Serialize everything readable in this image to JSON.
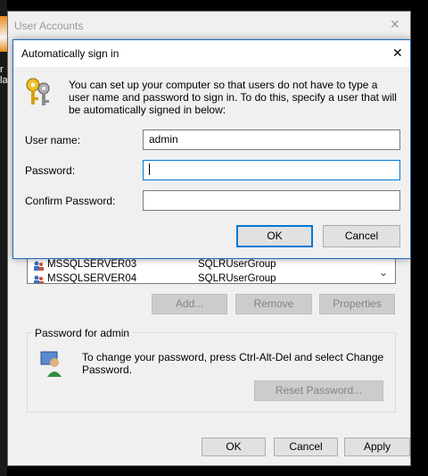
{
  "background": {
    "side_text": [
      "r",
      "la"
    ]
  },
  "outer_window": {
    "title": "User Accounts",
    "close_glyph": "✕",
    "users": [
      {
        "name": "MSSQLSERVER03",
        "group": "SQLRUserGroup"
      },
      {
        "name": "MSSQLSERVER04",
        "group": "SQLRUserGroup"
      }
    ],
    "scroll_glyph": "⌄",
    "buttons": {
      "add": "Add...",
      "remove": "Remove",
      "properties": "Properties"
    },
    "password_group": {
      "label": "Password for admin",
      "text": "To change your password, press Ctrl-Alt-Del and select Change Password.",
      "reset_button": "Reset Password..."
    },
    "footer": {
      "ok": "OK",
      "cancel": "Cancel",
      "apply": "Apply"
    }
  },
  "dialog": {
    "title": "Automatically sign in",
    "close_glyph": "✕",
    "description": "You can set up your computer so that users do not have to type a user name and password to sign in. To do this, specify a user that will be automatically signed in below:",
    "fields": {
      "username_label": "User name:",
      "username_value": "admin",
      "password_label": "Password:",
      "password_value": "",
      "confirm_label": "Confirm Password:",
      "confirm_value": ""
    },
    "buttons": {
      "ok": "OK",
      "cancel": "Cancel"
    }
  },
  "colors": {
    "accent": "#0078d7",
    "disabled_button": "#cccccc"
  }
}
